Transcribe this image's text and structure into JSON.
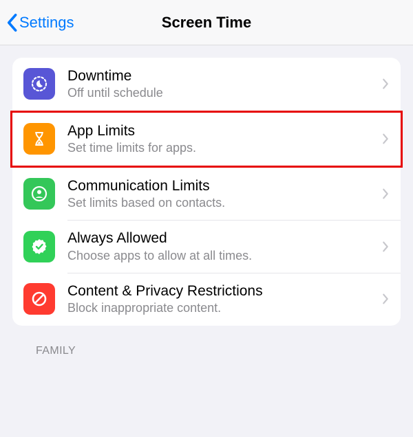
{
  "nav": {
    "back_label": "Settings",
    "title": "Screen Time"
  },
  "rows": [
    {
      "title": "Downtime",
      "sub": "Off until schedule",
      "icon": "clock-moon-icon",
      "color": "#5856d6"
    },
    {
      "title": "App Limits",
      "sub": "Set time limits for apps.",
      "icon": "hourglass-icon",
      "color": "#ff9500",
      "highlight": true
    },
    {
      "title": "Communication Limits",
      "sub": "Set limits based on contacts.",
      "icon": "contact-circle-icon",
      "color": "#34c759"
    },
    {
      "title": "Always Allowed",
      "sub": "Choose apps to allow at all times.",
      "icon": "check-seal-icon",
      "color": "#30d158"
    },
    {
      "title": "Content & Privacy Restrictions",
      "sub": "Block inappropriate content.",
      "icon": "no-symbol-icon",
      "color": "#ff3b30"
    }
  ],
  "section_header": "FAMILY"
}
